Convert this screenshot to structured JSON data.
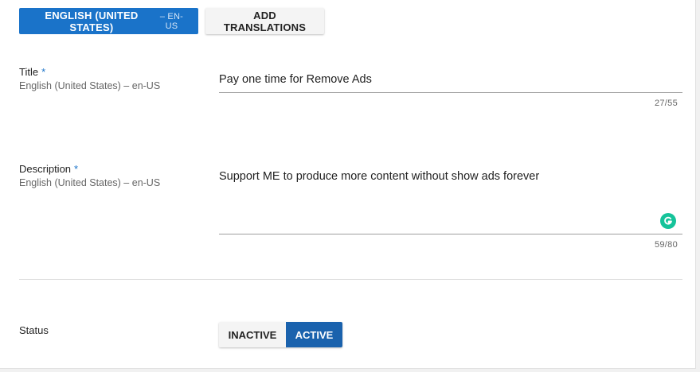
{
  "language_bar": {
    "current_language": "ENGLISH (UNITED STATES)",
    "current_code": "– EN-US",
    "add_translations_label": "ADD TRANSLATIONS"
  },
  "title_field": {
    "label": "Title",
    "required_marker": "*",
    "language": "English (United States) – en-US",
    "value": "Pay one time for Remove Ads",
    "counter": "27/55"
  },
  "description_field": {
    "label": "Description",
    "required_marker": "*",
    "language": "English (United States) – en-US",
    "value": "Support ME to produce more content without show ads forever",
    "counter": "59/80",
    "assistant_icon": "grammarly-icon"
  },
  "status_field": {
    "label": "Status",
    "options": [
      "INACTIVE",
      "ACTIVE"
    ],
    "selected": "ACTIVE"
  },
  "colors": {
    "primary": "#1a73c9",
    "active_toggle": "#1a62ad",
    "grammarly": "#15c39a"
  }
}
